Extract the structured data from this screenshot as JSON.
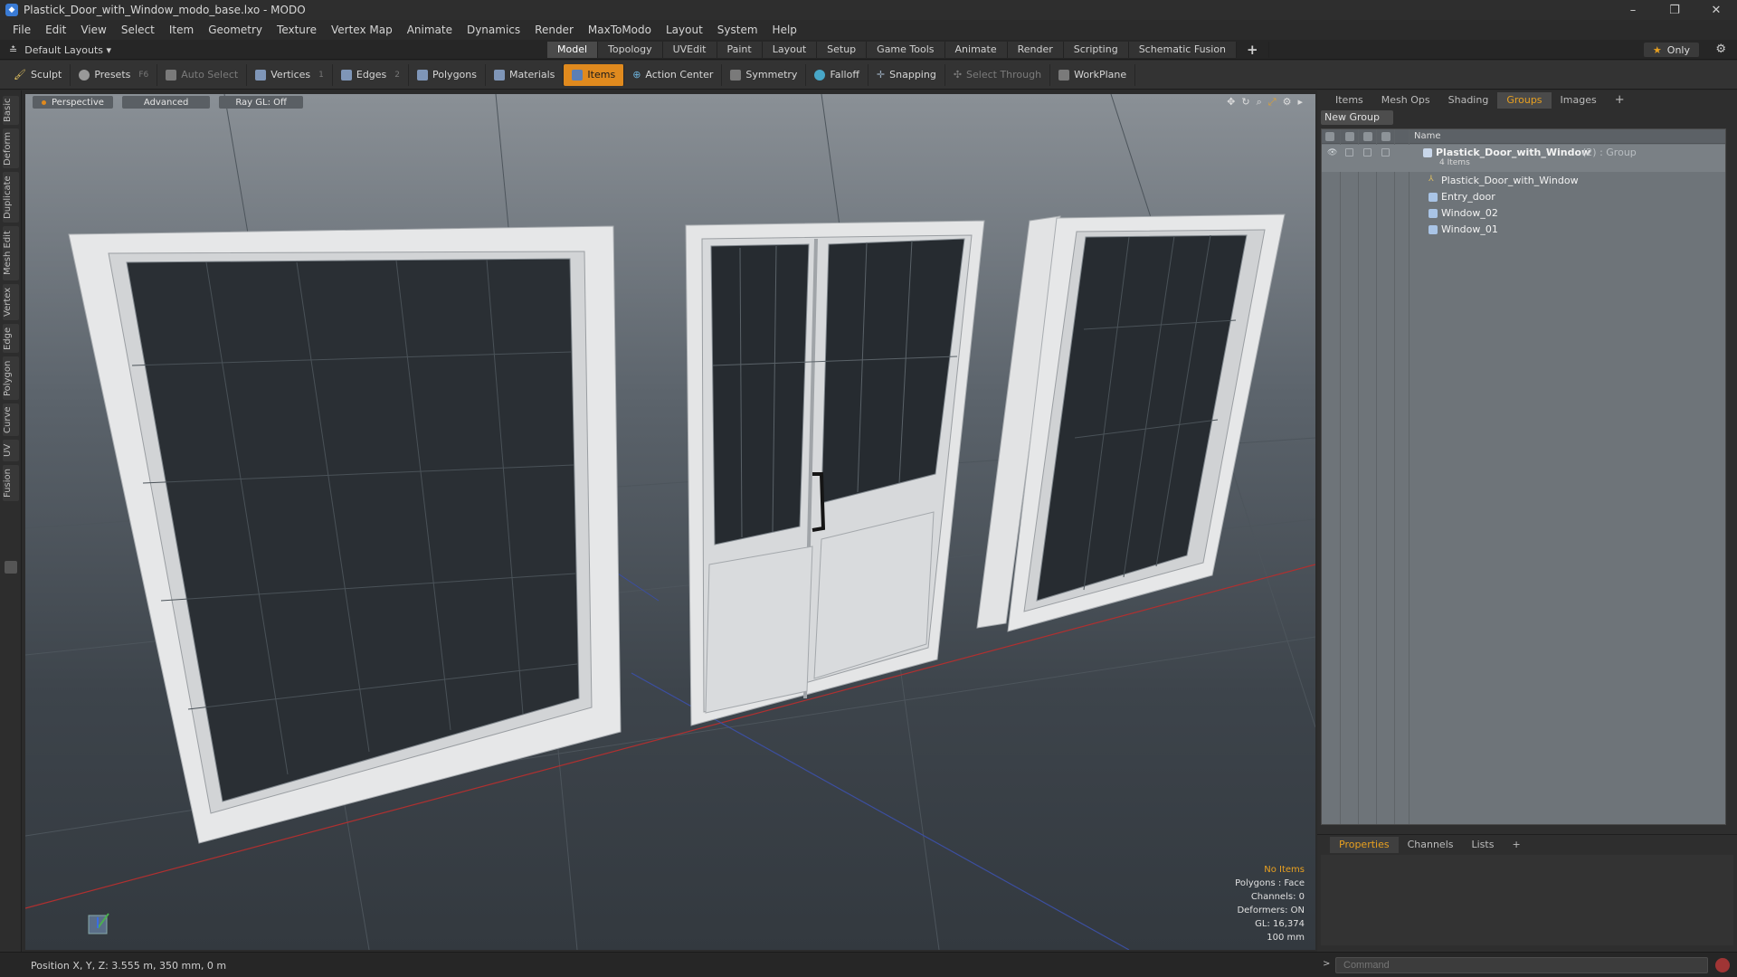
{
  "window": {
    "title": "Plastick_Door_with_Window_modo_base.lxo - MODO",
    "controls": [
      "–",
      "❐",
      "✕"
    ]
  },
  "menu": [
    "File",
    "Edit",
    "View",
    "Select",
    "Item",
    "Geometry",
    "Texture",
    "Vertex Map",
    "Animate",
    "Dynamics",
    "Render",
    "MaxToModo",
    "Layout",
    "System",
    "Help"
  ],
  "layoutbar": {
    "layout_name": "Default Layouts ▾",
    "tabs": [
      "Model",
      "Topology",
      "UVEdit",
      "Paint",
      "Layout",
      "Setup",
      "Game Tools",
      "Animate",
      "Render",
      "Scripting",
      "Schematic Fusion"
    ],
    "active_tab": "Model",
    "plus": "+",
    "only_label": "Only"
  },
  "toolbar": {
    "sculpt": "Sculpt",
    "presets": "Presets",
    "presets_key": "F6",
    "auto_select": "Auto Select",
    "vertices": "Vertices",
    "vertices_key": "1",
    "edges": "Edges",
    "edges_key": "2",
    "polygons": "Polygons",
    "materials": "Materials",
    "items": "Items",
    "action_center": "Action Center",
    "symmetry": "Symmetry",
    "falloff": "Falloff",
    "snapping": "Snapping",
    "select_through": "Select Through",
    "workplane": "WorkPlane"
  },
  "left_tabs": [
    "Basic",
    "Deform",
    "Duplicate",
    "Mesh Edit",
    "Vertex",
    "Edge",
    "Polygon",
    "Curve",
    "UV",
    "Fusion"
  ],
  "viewport": {
    "view_mode": "Perspective",
    "shading": "Advanced",
    "raygl": "Ray GL: Off",
    "info": {
      "selection": "No Items",
      "polygons": "Polygons : Face",
      "channels": "Channels: 0",
      "deformers": "Deformers: ON",
      "gl": "GL: 16,374",
      "grid": "100 mm"
    }
  },
  "right_panel": {
    "tabs": [
      "Items",
      "Mesh Ops",
      "Shading",
      "Groups",
      "Images"
    ],
    "active_tab": "Groups",
    "plus": "+",
    "new_group": "New Group",
    "column_name": "Name",
    "group": {
      "name": "Plastick_Door_with_Window",
      "meta": "(2) : Group",
      "count": "4 Items"
    },
    "items": [
      "Plastick_Door_with_Window",
      "Entry_door",
      "Window_02",
      "Window_01"
    ]
  },
  "properties": {
    "tabs": [
      "Properties",
      "Channels",
      "Lists"
    ],
    "active_tab": "Properties",
    "plus": "+"
  },
  "status": {
    "position": "Position X, Y, Z:   3.555 m, 350 mm, 0 m",
    "command_placeholder": "Command"
  },
  "colors": {
    "accent": "#e08a1e",
    "background": "#2b2b2b"
  }
}
